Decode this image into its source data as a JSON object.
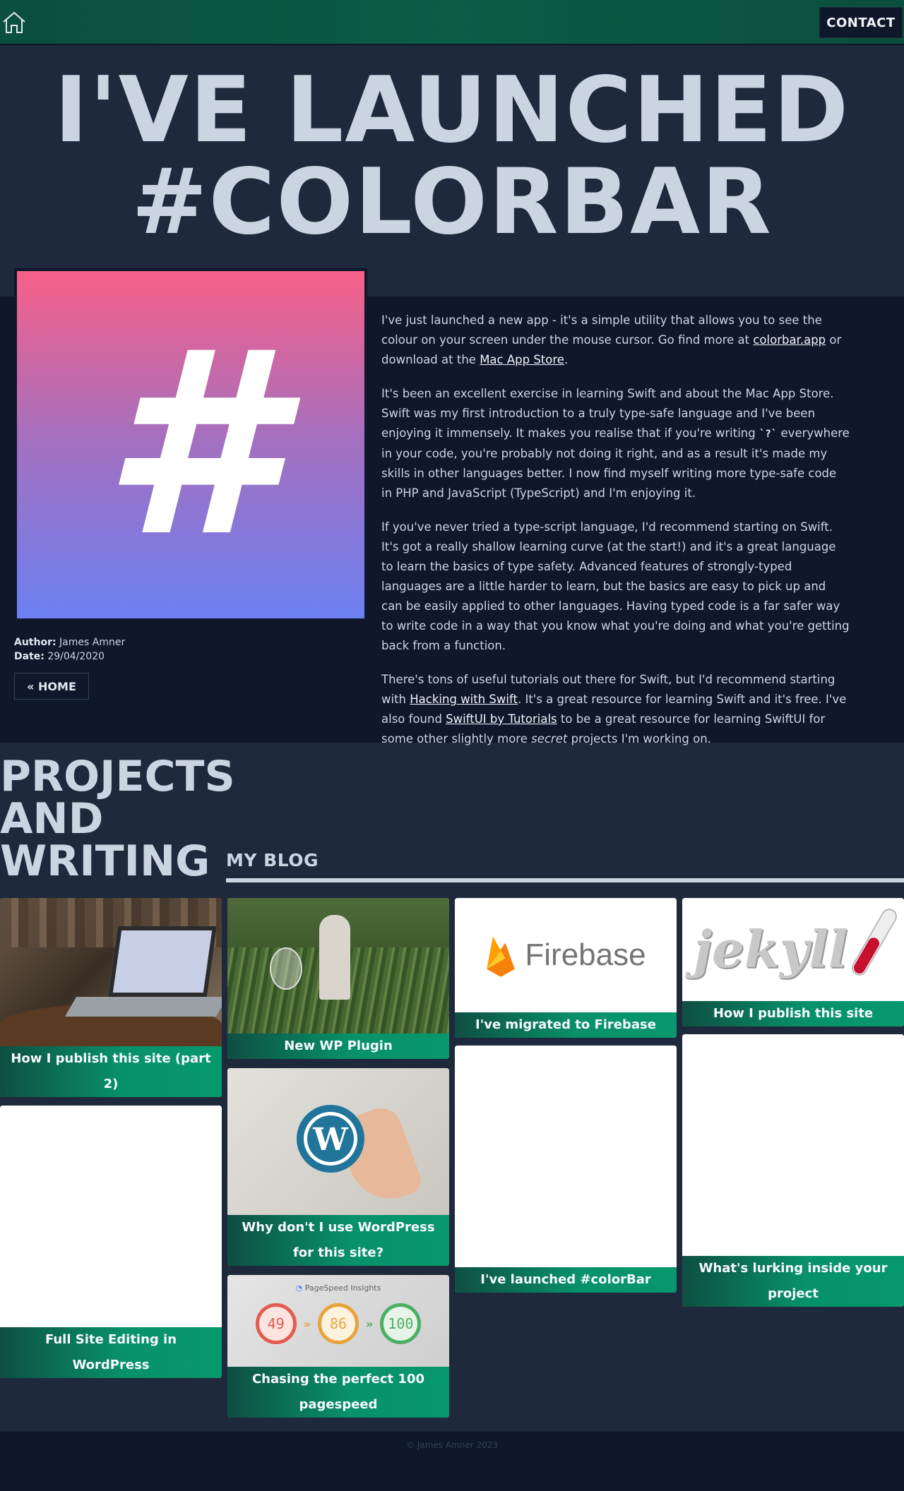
{
  "header": {
    "contact_label": "CONTACT"
  },
  "hero": {
    "title_line1": "I'VE LAUNCHED",
    "title_line2": "#COLORBAR"
  },
  "post": {
    "image_glyph": "#",
    "author_label": "Author:",
    "author": "James Amner",
    "date_label": "Date:",
    "date": "29/04/2020",
    "home_label": "« HOME",
    "p1_a": "I've just launched a new app - it's a simple utility that allows you to see the colour on your screen under the mouse cursor. Go find more at ",
    "p1_link1": "colorbar.app",
    "p1_b": " or download at the ",
    "p1_link2": "Mac App Store",
    "p1_c": ".",
    "p2_a": "It's been an excellent exercise in learning Swift and about the Mac App Store. Swift was my first introduction to a truly type-safe language and I've been enjoying it immensely. It makes you realise that if you're writing ",
    "p2_code": "`?`",
    "p2_b": " everywhere in your code, you're probably not doing it right, and as a result it's made my skills in other languages better. I now find myself writing more type-safe code in PHP and JavaScript (TypeScript) and I'm enjoying it.",
    "p3": "If you've never tried a type-script language, I'd recommend starting on Swift. It's got a really shallow learning curve (at the start!) and it's a great language to learn the basics of type safety. Advanced features of strongly-typed languages are a little harder to learn, but the basics are easy to pick up and can be easily applied to other languages. Having typed code is a far safer way to write code in a way that you know what you're doing and what you're getting back from a function.",
    "p4_a": "There's tons of useful tutorials out there for Swift, but I'd recommend starting with ",
    "p4_link1": "Hacking with Swift",
    "p4_b": ". It's a great resource for learning Swift and it's free. I've also found ",
    "p4_link2": "SwiftUI by Tutorials",
    "p4_c": " to be a great resource for learning SwiftUI for some other slightly more ",
    "p4_em": "secret",
    "p4_d": " projects I'm working on."
  },
  "projects": {
    "title_line1": "PROJECTS",
    "title_line2": "AND",
    "title_line3": "WRITING",
    "blog_label": "MY BLOG",
    "cards": [
      {
        "title": "How I publish this site (part 2)"
      },
      {
        "title": "Full Site Editing in WordPress"
      },
      {
        "title": "New WP Plugin"
      },
      {
        "title": "Why don't I use WordPress for this site?"
      },
      {
        "title": "Chasing the perfect 100 pagespeed"
      },
      {
        "title": "I've migrated to Firebase",
        "logo_text": "Firebase"
      },
      {
        "title": "I've launched #colorBar"
      },
      {
        "title": "How I publish this site",
        "logo_text": "jekyll"
      },
      {
        "title": "What's lurking inside your project"
      }
    ],
    "pagespeed": {
      "heading": "PageSpeed Insights",
      "scores": [
        "49",
        "86",
        "100"
      ],
      "arrow": "»"
    }
  },
  "footer": {
    "copyright": "© James Amner 2023"
  },
  "colors": {
    "accent": "#07986d",
    "header_green": "#0a5c45",
    "page_bg": "#1e293b",
    "panel_bg": "#0f172a",
    "text": "#cbd5e1"
  }
}
